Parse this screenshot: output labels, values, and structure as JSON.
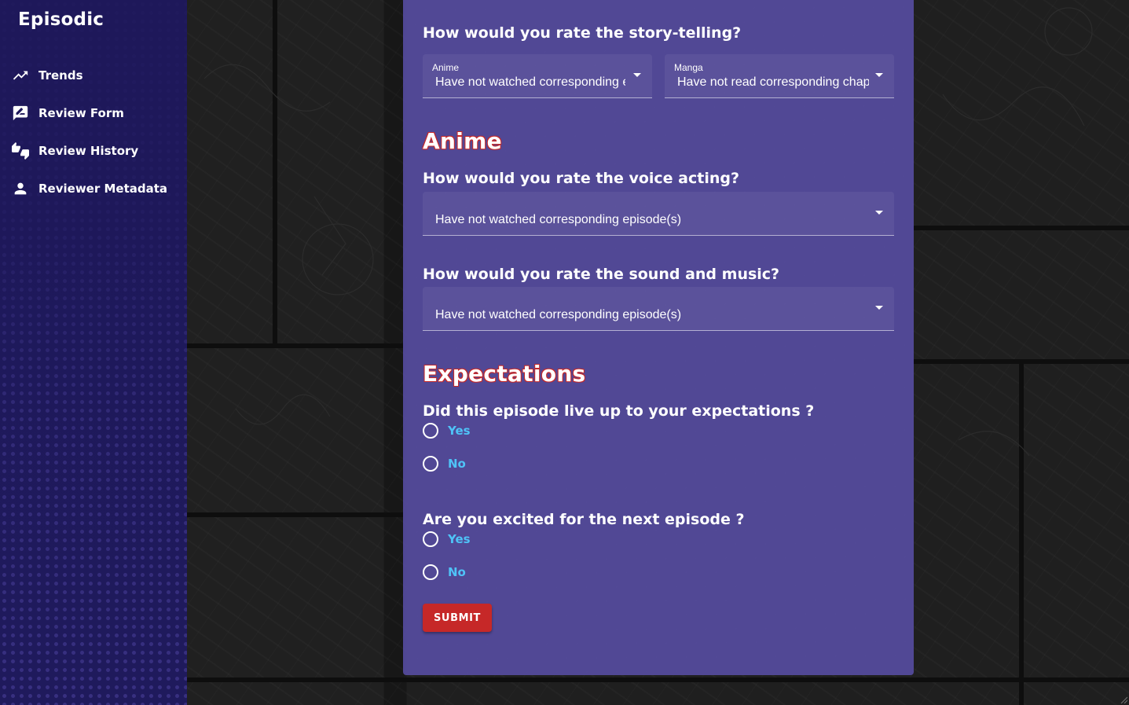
{
  "app": {
    "brand": "Episodic"
  },
  "sidebar": {
    "items": [
      {
        "label": "Trends",
        "icon": "trending-up-icon"
      },
      {
        "label": "Review Form",
        "icon": "rate-review-icon"
      },
      {
        "label": "Review History",
        "icon": "thumbs-up-down-icon"
      },
      {
        "label": "Reviewer Metadata",
        "icon": "person-icon"
      }
    ]
  },
  "form": {
    "storytelling": {
      "question": "How would you rate the story-telling?",
      "anime": {
        "label": "Anime",
        "value": "Have not watched corresponding episode(s)"
      },
      "manga": {
        "label": "Manga",
        "value": "Have not read corresponding chapter(s)"
      }
    },
    "anime_section": {
      "title": "Anime",
      "voice": {
        "question": "How would you rate the voice acting?",
        "value": "Have not watched corresponding episode(s)"
      },
      "sound": {
        "question": "How would you rate the sound and music?",
        "value": "Have not watched corresponding episode(s)"
      }
    },
    "expectations_section": {
      "title": "Expectations",
      "lived_up": {
        "question": "Did this episode live up to your expectations ?",
        "options": [
          "Yes",
          "No"
        ]
      },
      "excited": {
        "question": "Are you excited for the next episode ?",
        "options": [
          "Yes",
          "No"
        ]
      }
    },
    "submit_label": "SUBMIT"
  },
  "colors": {
    "sidebar_bg": "#1f1a5c",
    "card_bg": "#564ca0",
    "accent_red": "#c62828",
    "radio_label": "#4fc3f7"
  }
}
